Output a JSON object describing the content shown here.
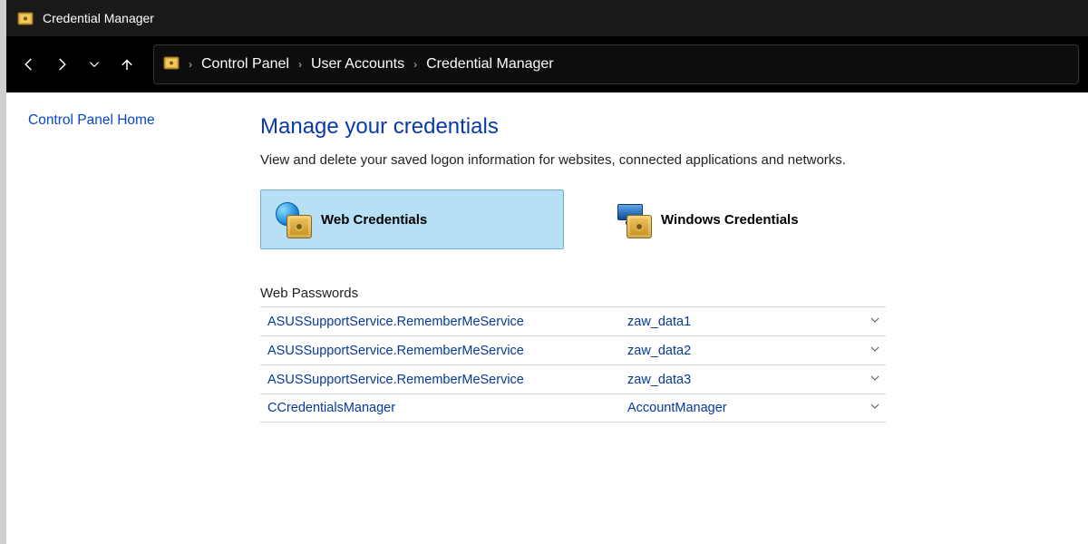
{
  "window": {
    "title": "Credential Manager"
  },
  "nav": {
    "breadcrumb": [
      "Control Panel",
      "User Accounts",
      "Credential Manager"
    ]
  },
  "sidebar": {
    "home_link": "Control Panel Home"
  },
  "main": {
    "title": "Manage your credentials",
    "description": "View and delete your saved logon information for websites, connected applications and networks.",
    "tabs": {
      "web": "Web Credentials",
      "windows": "Windows Credentials",
      "active": "web"
    },
    "section_label": "Web Passwords",
    "credentials": [
      {
        "service": "ASUSSupportService.RememberMeService",
        "account": "zaw_data1"
      },
      {
        "service": "ASUSSupportService.RememberMeService",
        "account": "zaw_data2"
      },
      {
        "service": "ASUSSupportService.RememberMeService",
        "account": "zaw_data3"
      },
      {
        "service": "CCredentialsManager",
        "account": "AccountManager"
      }
    ]
  }
}
